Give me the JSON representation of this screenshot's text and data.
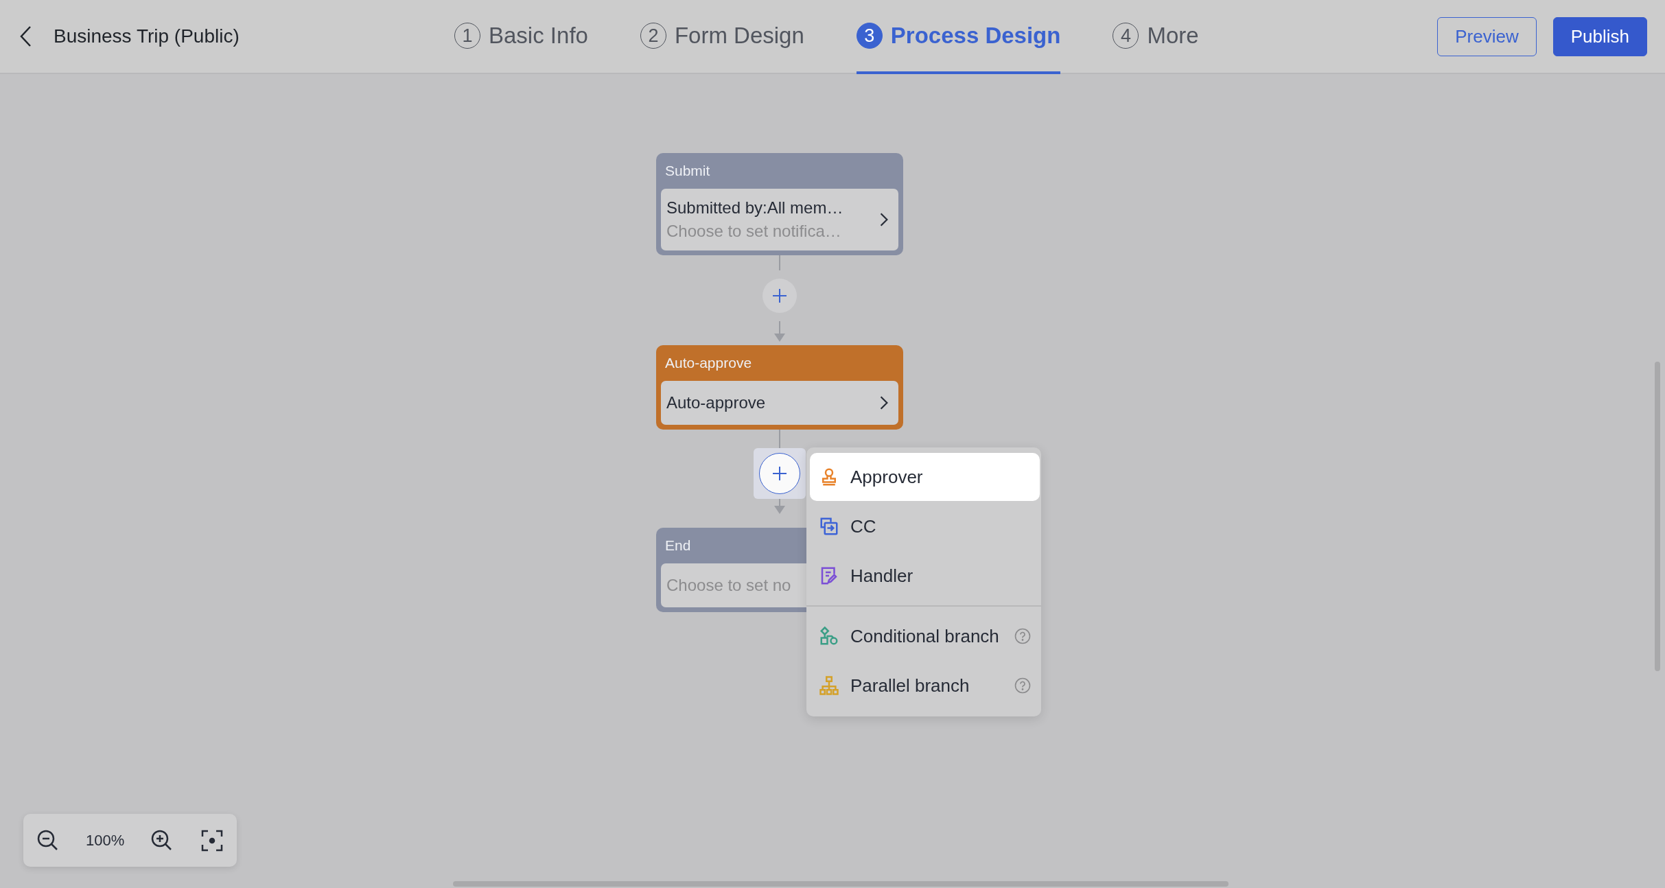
{
  "header": {
    "title": "Business Trip (Public)",
    "steps": [
      {
        "number": "1",
        "label": "Basic Info",
        "selected": false
      },
      {
        "number": "2",
        "label": "Form Design",
        "selected": false
      },
      {
        "number": "3",
        "label": "Process Design",
        "selected": true
      },
      {
        "number": "4",
        "label": "More",
        "selected": false
      }
    ],
    "buttons": [
      {
        "label": "Preview",
        "kind": "outline"
      },
      {
        "label": "Publish",
        "kind": "primary"
      }
    ]
  },
  "flow": [
    {
      "kind": "node",
      "title": "Submit",
      "color": "#878ea3",
      "chevron": true,
      "lines": [
        {
          "text": "Submitted by:All mem…",
          "kind": "value"
        },
        {
          "text": "Choose to set notifica…",
          "kind": "hint"
        }
      ]
    },
    {
      "kind": "add",
      "selected": false
    },
    {
      "kind": "node",
      "title": "Auto-approve",
      "color": "#c0702a",
      "chevron": true,
      "lines": [
        {
          "text": "Auto-approve",
          "kind": "value"
        }
      ]
    },
    {
      "kind": "add",
      "selected": true
    },
    {
      "kind": "node",
      "title": "End",
      "color": "#878ea3",
      "lines": [
        {
          "text": "Choose to set no",
          "kind": "hint"
        }
      ]
    }
  ],
  "add_menu": {
    "groups": [
      [
        {
          "label": "Approver",
          "kind": "approver",
          "selected": true,
          "help": false
        },
        {
          "label": "CC",
          "kind": "cc",
          "selected": false,
          "help": false
        },
        {
          "label": "Handler",
          "kind": "handler",
          "selected": false,
          "help": false
        }
      ],
      [
        {
          "label": "Conditional branch",
          "kind": "conditional",
          "selected": false,
          "help": true
        },
        {
          "label": "Parallel branch",
          "kind": "parallel",
          "selected": false,
          "help": true
        }
      ]
    ]
  },
  "zoom_controls": {
    "zoom_label": "100%"
  }
}
